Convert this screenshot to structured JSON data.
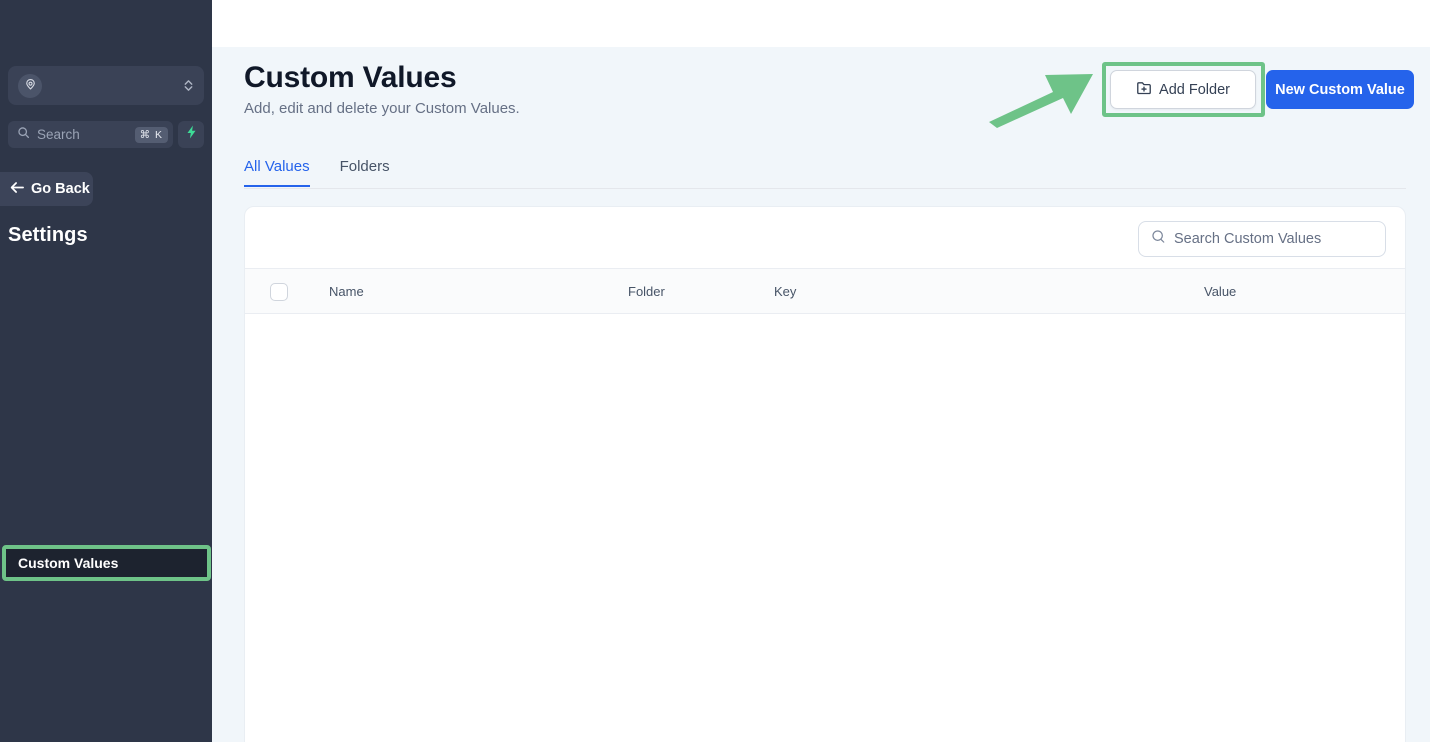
{
  "sidebar": {
    "org_switcher": {
      "name": "org-switcher",
      "icon": "user-location-avatar-icon",
      "value": ""
    },
    "search": {
      "placeholder": "Search",
      "shortcut": "⌘ K",
      "icon": "search-icon"
    },
    "quick_action": {
      "icon": "lightning-bolt-icon"
    },
    "go_back": {
      "label": "Go Back",
      "icon": "arrow-left-icon"
    },
    "section_title": "Settings",
    "active_item": {
      "label": "Custom Values",
      "highlighted": true
    }
  },
  "header": {
    "title": "Custom Values",
    "subtitle": "Add, edit and delete your Custom Values.",
    "add_folder_label": "Add Folder",
    "add_folder_icon": "folder-plus-icon",
    "new_value_label": "New Custom Value"
  },
  "tabs": [
    {
      "label": "All Values",
      "active": true
    },
    {
      "label": "Folders",
      "active": false
    }
  ],
  "table": {
    "search_placeholder": "Search Custom Values",
    "search_icon": "search-icon",
    "columns": [
      "Name",
      "Folder",
      "Key",
      "Value"
    ],
    "rows": []
  },
  "annotations": {
    "arrow": {
      "name": "green-pointer-arrow",
      "target": "Add Folder"
    },
    "highlight_color": "#6ec388"
  },
  "colors": {
    "sidebar_bg": "#2e3648",
    "content_bg": "#f1f6fa",
    "accent_blue": "#2563eb",
    "highlight_green": "#6ec388",
    "title_text": "#101828",
    "muted_text": "#667085"
  }
}
